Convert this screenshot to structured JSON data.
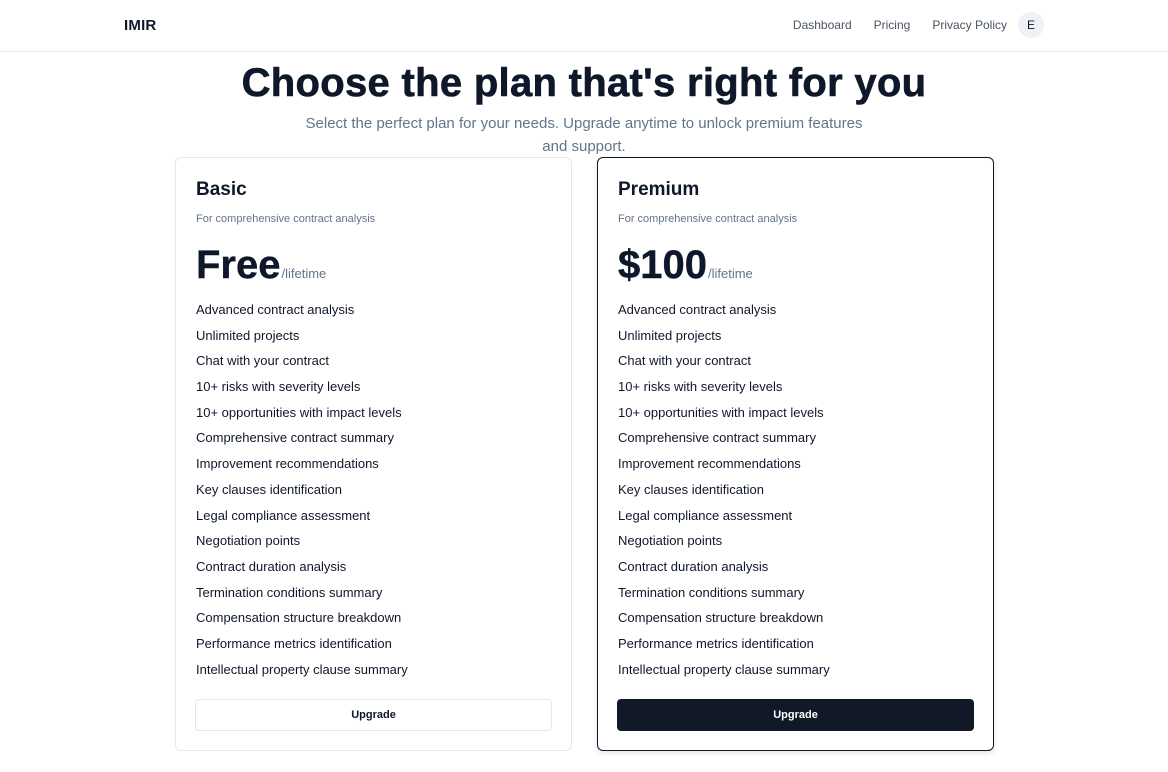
{
  "navbar": {
    "brand": "IMIR",
    "links": [
      "Dashboard",
      "Pricing",
      "Privacy Policy"
    ],
    "avatar_initial": "E"
  },
  "hero": {
    "title": "Choose the plan that's right for you",
    "subtitle": "Select the perfect plan for your needs. Upgrade anytime to unlock premium features and support."
  },
  "plans": [
    {
      "name": "Basic",
      "description": "For comprehensive contract analysis",
      "price": "Free",
      "period": "/lifetime",
      "button_label": "Upgrade",
      "features": [
        "Advanced contract analysis",
        "Unlimited projects",
        "Chat with your contract",
        "10+ risks with severity levels",
        "10+ opportunities with impact levels",
        "Comprehensive contract summary",
        "Improvement recommendations",
        "Key clauses identification",
        "Legal compliance assessment",
        "Negotiation points",
        "Contract duration analysis",
        "Termination conditions summary",
        "Compensation structure breakdown",
        "Performance metrics identification",
        "Intellectual property clause summary"
      ]
    },
    {
      "name": "Premium",
      "description": "For comprehensive contract analysis",
      "price": "$100",
      "period": "/lifetime",
      "button_label": "Upgrade",
      "features": [
        "Advanced contract analysis",
        "Unlimited projects",
        "Chat with your contract",
        "10+ risks with severity levels",
        "10+ opportunities with impact levels",
        "Comprehensive contract summary",
        "Improvement recommendations",
        "Key clauses identification",
        "Legal compliance assessment",
        "Negotiation points",
        "Contract duration analysis",
        "Termination conditions summary",
        "Compensation structure breakdown",
        "Performance metrics identification",
        "Intellectual property clause summary"
      ]
    }
  ],
  "colors": {
    "primary": "#111827",
    "muted_text": "#64748b",
    "border": "#e5e7eb"
  }
}
